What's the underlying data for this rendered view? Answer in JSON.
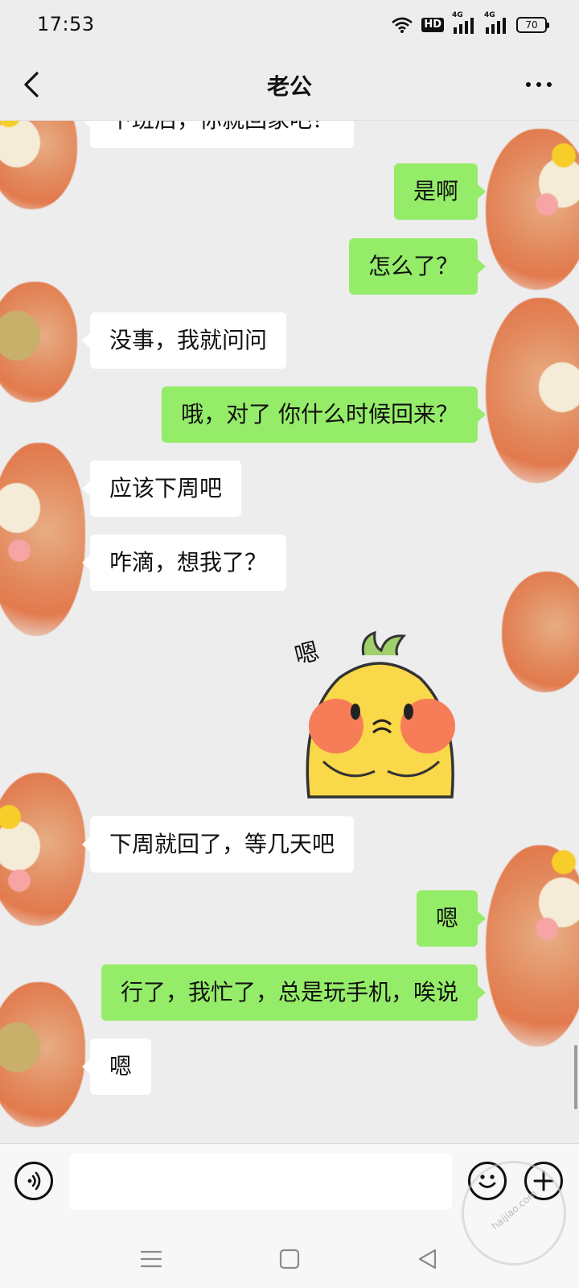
{
  "status_bar": {
    "time": "17:53",
    "network_badge": "HD",
    "signal_1_label": "4G",
    "signal_2_label": "4G",
    "battery_level": "70"
  },
  "header": {
    "title": "老公",
    "back_icon": "chevron-left-icon",
    "more_icon": "more-dots-icon"
  },
  "messages": [
    {
      "side": "left",
      "text": "下班后，你就回家吧？"
    },
    {
      "side": "right",
      "text": "是啊"
    },
    {
      "side": "right",
      "text": "怎么了？"
    },
    {
      "side": "left",
      "text": "没事，我就问问"
    },
    {
      "side": "right",
      "text": "哦，对了 你什么时候回来？"
    },
    {
      "side": "left",
      "text": "应该下周吧"
    },
    {
      "side": "left",
      "text": "咋滴，想我了？"
    },
    {
      "side": "right",
      "type": "sticker",
      "text": "嗯"
    },
    {
      "side": "left",
      "text": "下周就回了，等几天吧"
    },
    {
      "side": "right",
      "text": "嗯"
    },
    {
      "side": "right",
      "text": "行了，我忙了，总是玩手机，唉说"
    },
    {
      "side": "left",
      "text": "嗯"
    }
  ],
  "input_bar": {
    "placeholder": "",
    "voice_icon": "voice-icon",
    "emoji_icon": "emoji-icon",
    "plus_icon": "plus-icon"
  },
  "watermark": {
    "text": "haijiao.com"
  },
  "colors": {
    "background": "#ededed",
    "sent_bubble": "#95ec69",
    "received_bubble": "#ffffff"
  }
}
